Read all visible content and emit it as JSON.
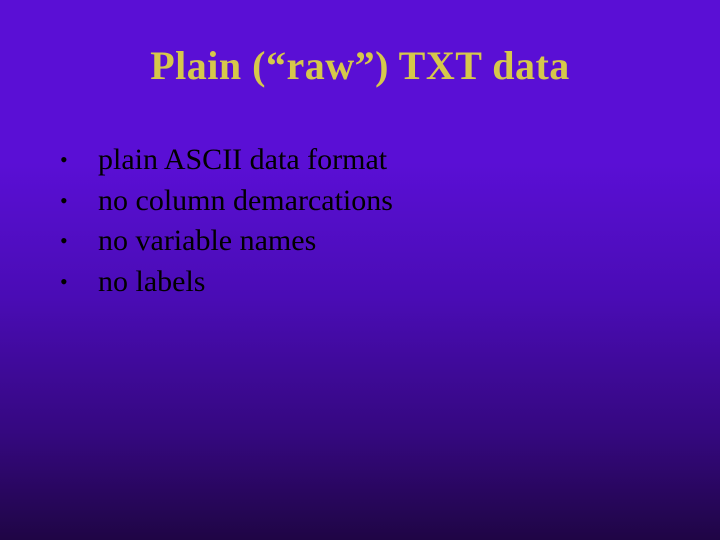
{
  "title": "Plain (“raw”) TXT data",
  "bullets": [
    "plain ASCII data format",
    "no column demarcations",
    "no variable names",
    "no labels"
  ],
  "colors": {
    "title": "#d6c84a",
    "body": "#000000",
    "bg_top": "#5a0fd5",
    "bg_bottom": "#1f0545"
  }
}
